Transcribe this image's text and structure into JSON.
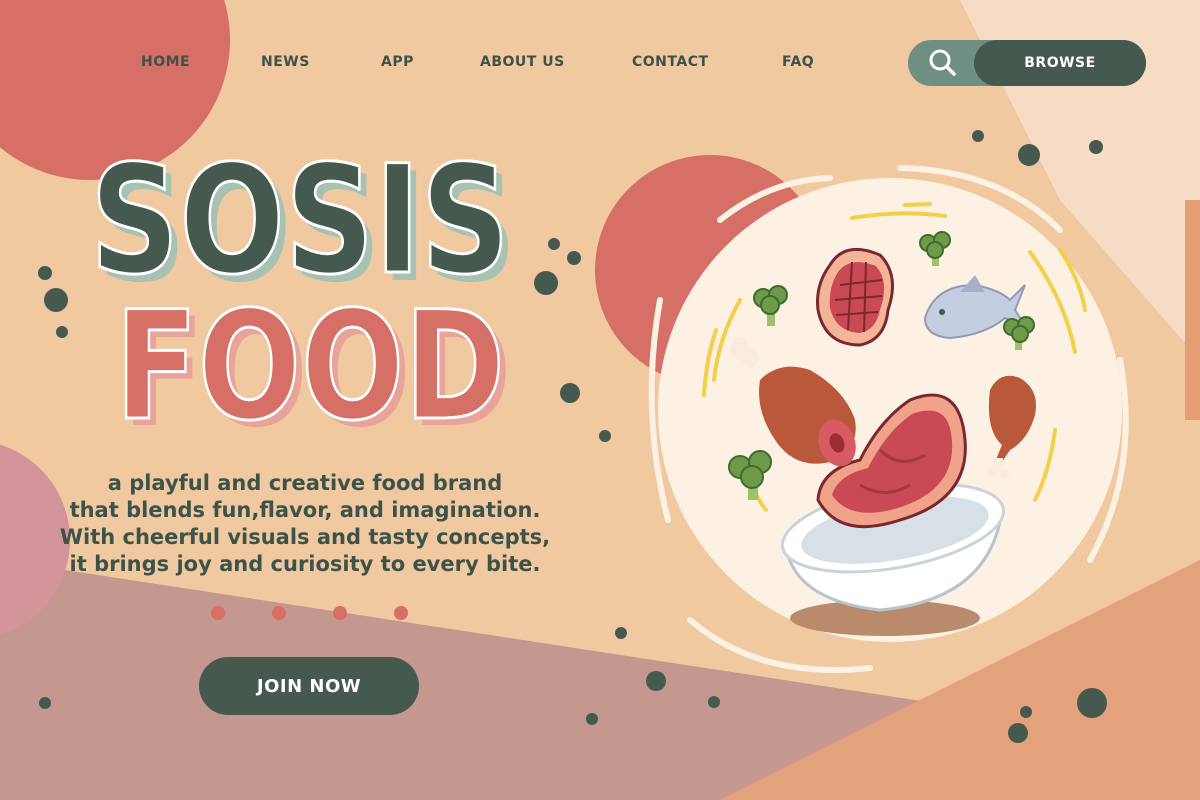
{
  "nav": {
    "items": [
      {
        "label": "HOME"
      },
      {
        "label": "NEWS"
      },
      {
        "label": "APP"
      },
      {
        "label": "ABOUT US"
      },
      {
        "label": "CONTACT"
      },
      {
        "label": "FAQ"
      }
    ],
    "browse_label": "BROWSE",
    "search_icon": "search-icon"
  },
  "hero": {
    "title_line1": "SOSIS",
    "title_line2": "FOOD",
    "description": [
      "a playful and creative food brand",
      "that blends fun,flavor, and imagination.",
      "With cheerful visuals and tasty concepts,",
      "it brings joy and curiosity to every bite."
    ],
    "cta_label": "JOIN NOW",
    "carousel_dot_count": 4
  },
  "colors": {
    "background": "#f0c9a1",
    "coral": "#d66f66",
    "dark_green": "#46594f",
    "sage": "#6f8f83",
    "cream": "#fdf1e4"
  }
}
